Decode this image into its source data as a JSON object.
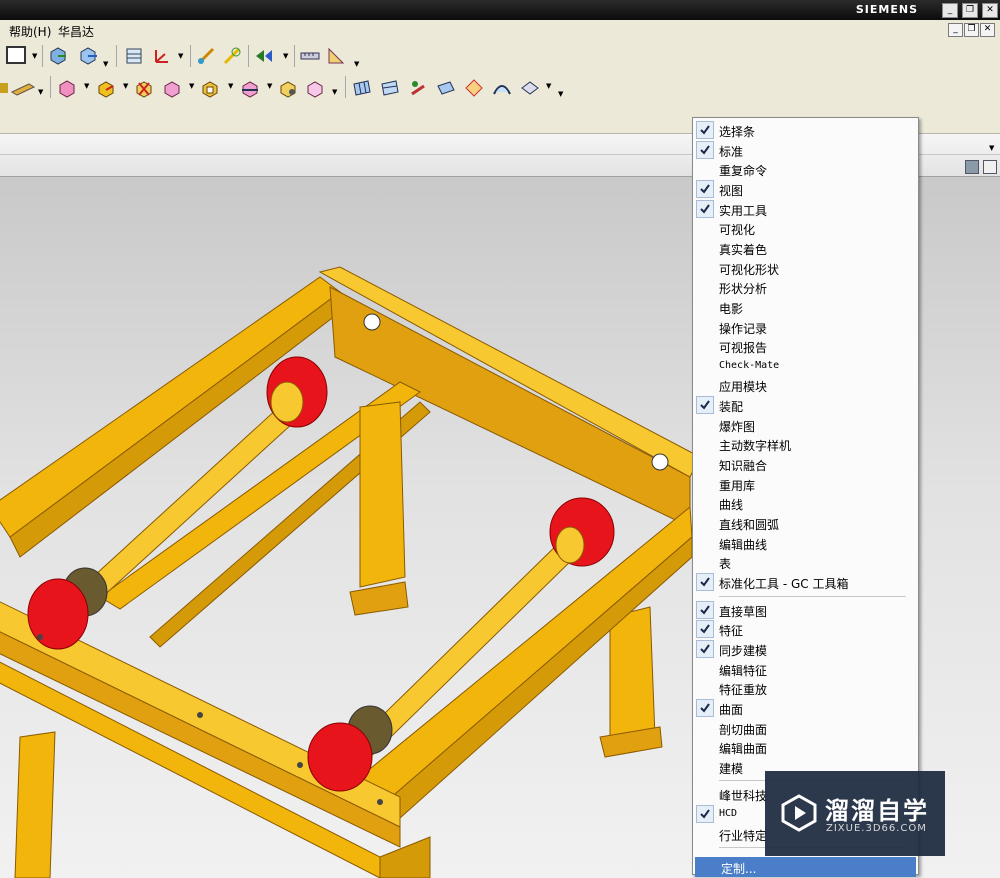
{
  "window": {
    "brand": "SIEMENS"
  },
  "menubar": {
    "items": [
      "帮助(H)",
      "华昌达"
    ]
  },
  "context_menu": {
    "groups": [
      [
        {
          "label": "选择条",
          "checked": true
        },
        {
          "label": "标准",
          "checked": true
        },
        {
          "label": "重复命令",
          "checked": false
        },
        {
          "label": "视图",
          "checked": true
        },
        {
          "label": "实用工具",
          "checked": true
        },
        {
          "label": "可视化",
          "checked": false
        },
        {
          "label": "真实着色",
          "checked": false
        },
        {
          "label": "可视化形状",
          "checked": false
        },
        {
          "label": "形状分析",
          "checked": false
        },
        {
          "label": "电影",
          "checked": false
        },
        {
          "label": "操作记录",
          "checked": false
        },
        {
          "label": "可视报告",
          "checked": false
        },
        {
          "label": "Check-Mate",
          "checked": false
        },
        {
          "label": "应用模块",
          "checked": false
        },
        {
          "label": "装配",
          "checked": true
        },
        {
          "label": "爆炸图",
          "checked": false
        },
        {
          "label": "主动数字样机",
          "checked": false
        },
        {
          "label": "知识融合",
          "checked": false
        },
        {
          "label": "重用库",
          "checked": false
        },
        {
          "label": "曲线",
          "checked": false
        },
        {
          "label": "直线和圆弧",
          "checked": false
        },
        {
          "label": "编辑曲线",
          "checked": false
        },
        {
          "label": "表",
          "checked": false
        },
        {
          "label": "标准化工具 - GC 工具箱",
          "checked": true
        }
      ],
      [
        {
          "label": "直接草图",
          "checked": true
        },
        {
          "label": "特征",
          "checked": true
        },
        {
          "label": "同步建模",
          "checked": true
        },
        {
          "label": "编辑特征",
          "checked": false
        },
        {
          "label": "特征重放",
          "checked": false
        },
        {
          "label": "曲面",
          "checked": true
        },
        {
          "label": "剖切曲面",
          "checked": false
        },
        {
          "label": "编辑曲面",
          "checked": false
        },
        {
          "label": "建模",
          "checked": false
        }
      ],
      [
        {
          "label": "峰世科技",
          "checked": false
        },
        {
          "label": "HCD",
          "checked": true
        },
        {
          "label": "行业特定",
          "checked": false
        }
      ]
    ],
    "customize_label": "定制..."
  },
  "watermark": {
    "title": "溜溜自学",
    "subtitle": "ZIXUE.3D66.COM"
  },
  "colors": {
    "frame_yellow": "#f2b50c",
    "roller_red": "#e8141c",
    "highlight": "#4a7ec8"
  }
}
